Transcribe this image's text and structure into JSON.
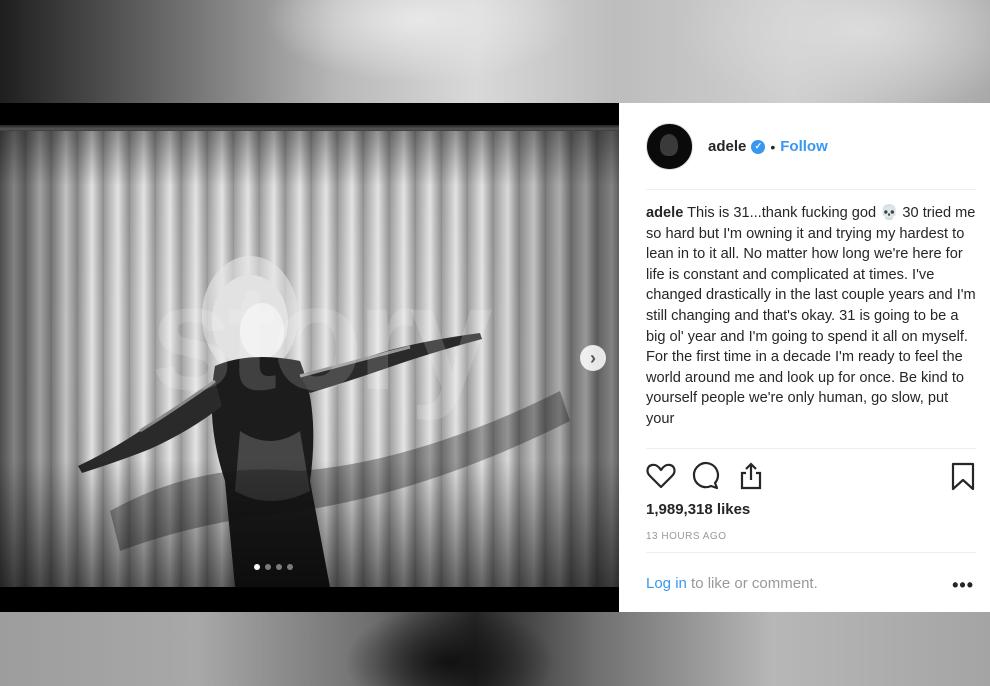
{
  "post": {
    "username": "adele",
    "separator": "•",
    "follow_label": "Follow",
    "caption_text": "This is 31...thank fucking god 💀 30 tried me so hard but I'm owning it and trying my hardest to lean in to it all. No matter how long we're here for life is constant and complicated at times. I've changed drastically in the last couple years and I'm still changing and that's okay. 31 is going to be a big ol' year and I'm going to spend it all on myself. For the first time in a decade I'm ready to feel the world around me and look up for once. Be kind to yourself people we're only human, go slow, put your",
    "likes": "1,989,318 likes",
    "time_ago": "13 HOURS AGO",
    "login_label": "Log in",
    "comment_prompt": " to like or comment.",
    "more_label": "•••",
    "carousel_next": "›",
    "carousel_total": 4,
    "carousel_active": 1,
    "watermark_text": "story"
  },
  "colors": {
    "link_blue": "#3897f0",
    "text": "#262626",
    "muted": "#999999"
  },
  "icons": [
    "heart-icon",
    "comment-icon",
    "share-icon",
    "bookmark-icon",
    "verified-badge-icon",
    "chevron-right-icon",
    "more-options-icon"
  ]
}
